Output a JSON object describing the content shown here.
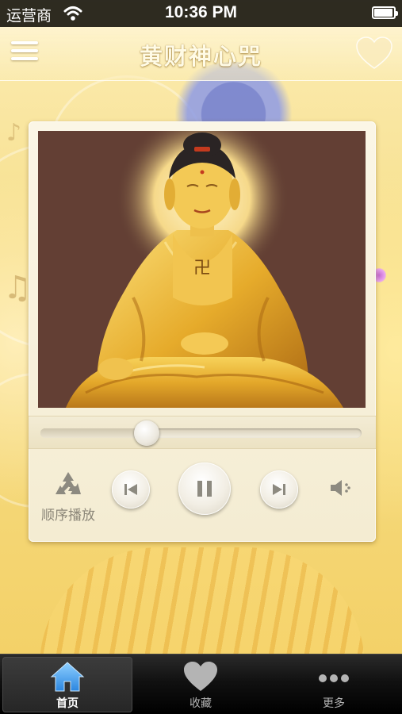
{
  "status_bar": {
    "carrier": "运营商",
    "time": "10:36 PM",
    "battery_level": 0.95
  },
  "nav": {
    "title": "黄财神心咒",
    "menu_icon": "hamburger-menu-icon",
    "favorite_icon": "heart-icon"
  },
  "player": {
    "artwork": "golden seated Buddha image",
    "progress": 0.33,
    "play_mode_icon": "recycle-icon",
    "play_mode_label": "顺序播放",
    "prev_icon": "skip-previous-icon",
    "pause_icon": "pause-icon",
    "next_icon": "skip-next-icon",
    "volume_icon": "speaker-icon",
    "colors": {
      "card": "#f7f0da",
      "button": "#f2eee4",
      "icon": "#8d8a80"
    }
  },
  "tabs": [
    {
      "label": "首页",
      "icon": "home-icon",
      "active": true
    },
    {
      "label": "收藏",
      "icon": "heart-icon",
      "active": false
    },
    {
      "label": "更多",
      "icon": "more-dots-icon",
      "active": false
    }
  ]
}
